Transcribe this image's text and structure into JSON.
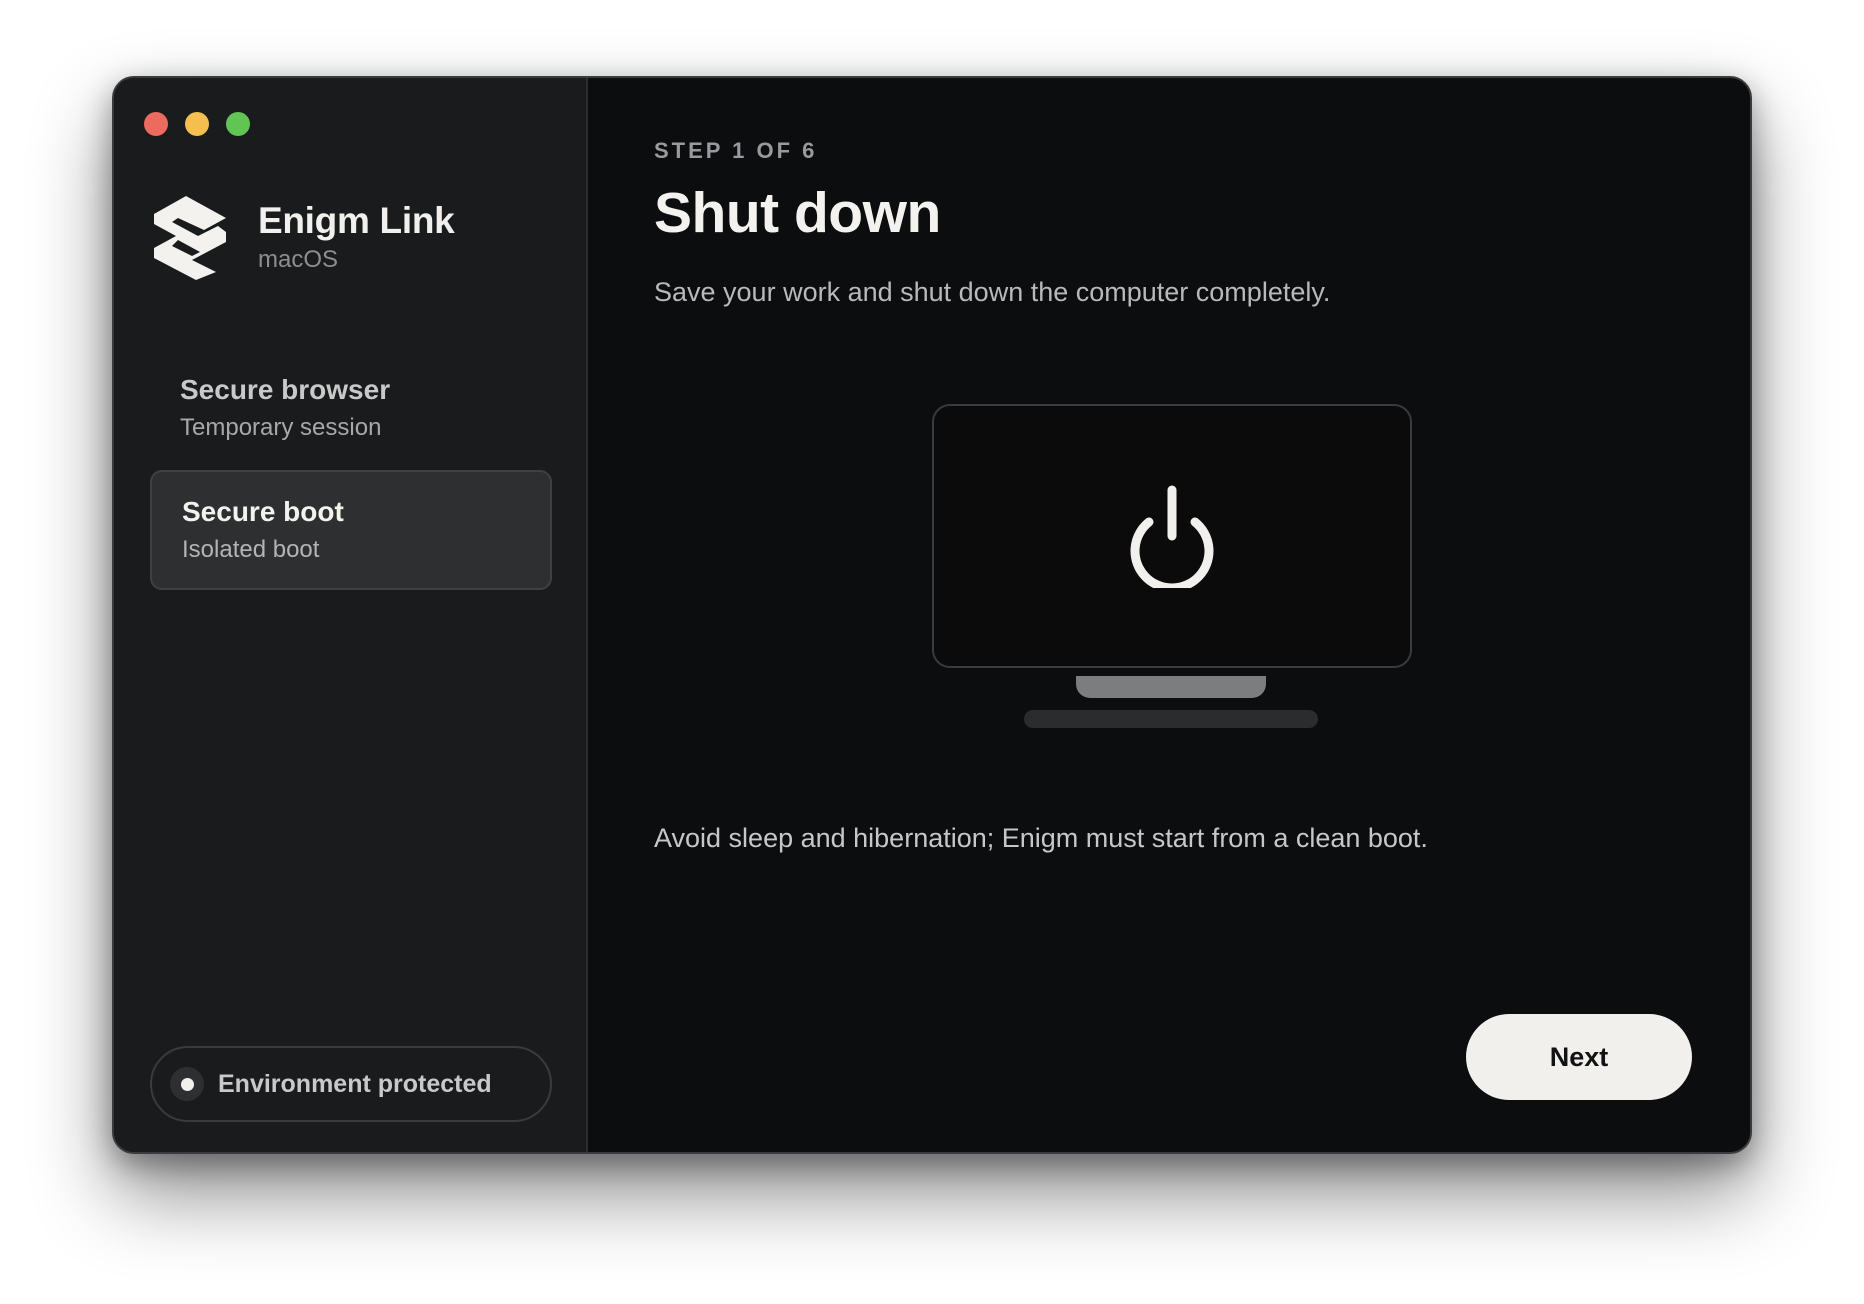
{
  "app": {
    "name": "Enigm Link",
    "platform": "macOS"
  },
  "sidebar": {
    "items": [
      {
        "title": "Secure browser",
        "subtitle": "Temporary session",
        "selected": false
      },
      {
        "title": "Secure boot",
        "subtitle": "Isolated boot",
        "selected": true
      }
    ],
    "status": "Environment protected"
  },
  "main": {
    "step": "STEP 1 OF 6",
    "title": "Shut down",
    "description": "Save your work and shut down the computer completely.",
    "illustration_icon": "power-icon",
    "note": "Avoid sleep and hibernation; Enigm must start from a clean boot.",
    "next_label": "Next"
  },
  "colors": {
    "window_bg": "#0c0d0f",
    "sidebar_bg": "#1a1b1d",
    "selected_item_bg": "#2e2f31",
    "primary_button_bg": "#f2f0ec",
    "close": "#ed6a5e",
    "minimize": "#f5bf4f",
    "zoom": "#61c554"
  }
}
